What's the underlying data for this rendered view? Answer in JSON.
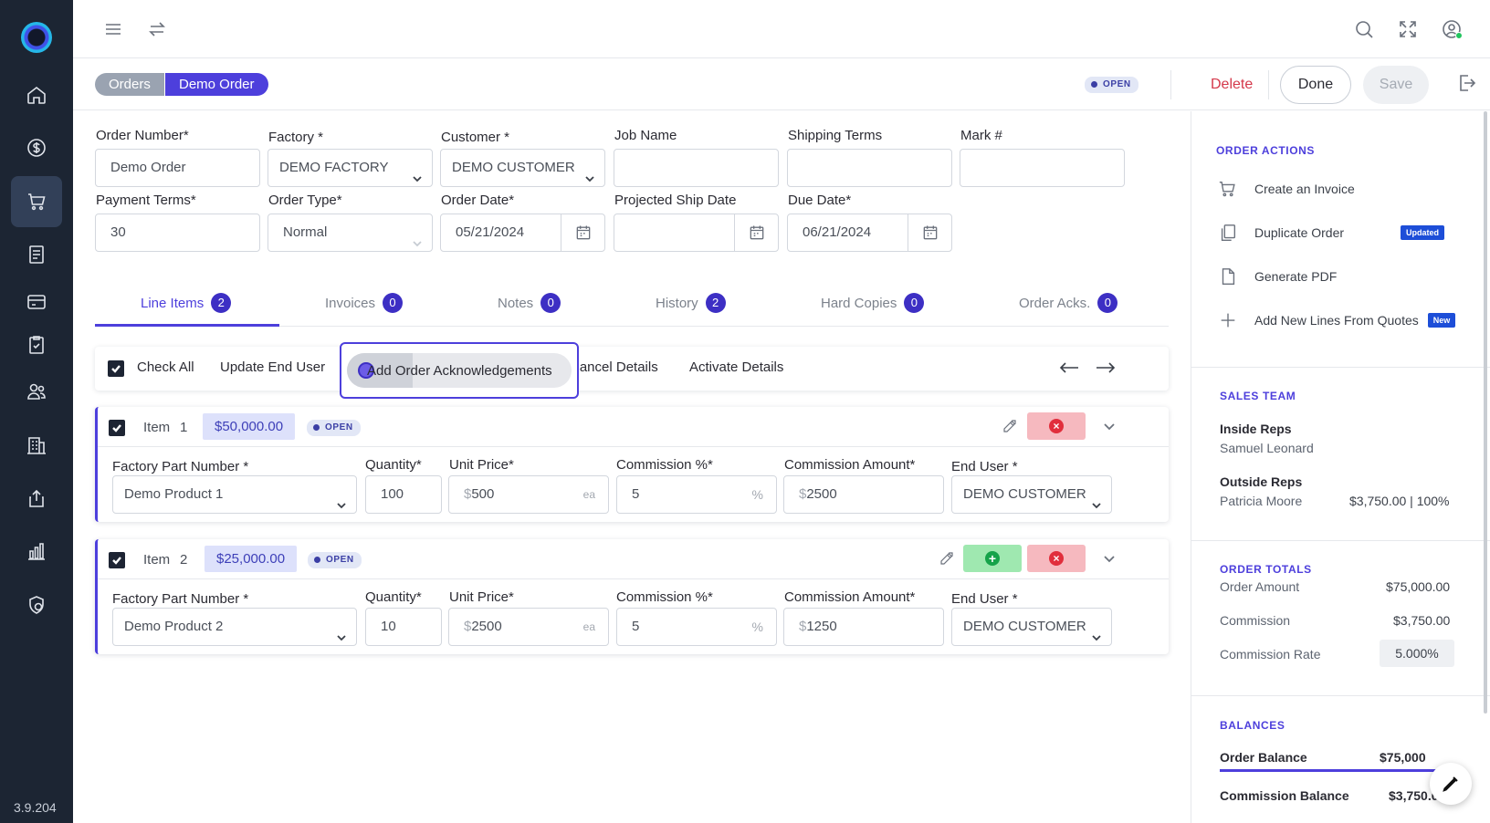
{
  "app": {
    "version": "3.9.204"
  },
  "sidebar": {
    "items": [
      "home-icon",
      "dollar-icon",
      "cart-icon",
      "document-icon",
      "credit-card-icon",
      "clipboard-check-icon",
      "users-icon",
      "building-icon",
      "share-icon",
      "bar-chart-icon",
      "settings-shield-icon"
    ],
    "active": "cart-icon"
  },
  "breadcrumb": {
    "parent": "Orders",
    "current": "Demo Order"
  },
  "status": "OPEN",
  "actions": {
    "delete": "Delete",
    "done": "Done",
    "save": "Save"
  },
  "form": {
    "order_number": {
      "label": "Order Number*",
      "value": "Demo Order"
    },
    "factory": {
      "label": "Factory *",
      "value": "DEMO FACTORY"
    },
    "customer": {
      "label": "Customer *",
      "value": "DEMO CUSTOMER"
    },
    "job_name": {
      "label": "Job Name",
      "value": ""
    },
    "shipping_terms": {
      "label": "Shipping Terms",
      "value": ""
    },
    "mark": {
      "label": "Mark #",
      "value": ""
    },
    "payment_terms": {
      "label": "Payment Terms*",
      "value": "30"
    },
    "order_type": {
      "label": "Order Type*",
      "value": "Normal"
    },
    "order_date": {
      "label": "Order Date*",
      "value": "05/21/2024"
    },
    "projected_ship_date": {
      "label": "Projected Ship Date",
      "value": ""
    },
    "due_date": {
      "label": "Due Date*",
      "value": "06/21/2024"
    }
  },
  "tabs": [
    {
      "label": "Line Items",
      "count": "2"
    },
    {
      "label": "Invoices",
      "count": "0"
    },
    {
      "label": "Notes",
      "count": "0"
    },
    {
      "label": "History",
      "count": "2"
    },
    {
      "label": "Hard Copies",
      "count": "0"
    },
    {
      "label": "Order Acks.",
      "count": "0"
    }
  ],
  "toolbar": {
    "check_all": "Check All",
    "update_end_user": "Update End User",
    "add_order_acks": "Add Order Acknowledgements",
    "cancel_details": "Cancel Details",
    "activate_details": "Activate Details"
  },
  "line_labels": {
    "item": "Item",
    "part_number": "Factory Part Number *",
    "quantity": "Quantity*",
    "unit_price": "Unit Price*",
    "commission_pct": "Commission %*",
    "commission_amount": "Commission Amount*",
    "end_user": "End User *",
    "currency": "$",
    "unit": "ea",
    "percent": "%"
  },
  "line_items": [
    {
      "number": "1",
      "amount": "$50,000.00",
      "status": "OPEN",
      "part": "Demo Product 1",
      "quantity": "100",
      "unit_price": "500",
      "commission_pct": "5",
      "commission_amount": "2500",
      "end_user": "DEMO CUSTOMER"
    },
    {
      "number": "2",
      "amount": "$25,000.00",
      "status": "OPEN",
      "part": "Demo Product 2",
      "quantity": "10",
      "unit_price": "2500",
      "commission_pct": "5",
      "commission_amount": "1250",
      "end_user": "DEMO CUSTOMER"
    }
  ],
  "order_actions": {
    "title": "ORDER ACTIONS",
    "items": [
      {
        "label": "Create an Invoice",
        "tag": ""
      },
      {
        "label": "Duplicate Order",
        "tag": "Updated"
      },
      {
        "label": "Generate PDF",
        "tag": ""
      },
      {
        "label": "Add New Lines From Quotes",
        "tag": "New"
      }
    ]
  },
  "sales_team": {
    "title": "SALES TEAM",
    "inside_label": "Inside Reps",
    "inside_name": "Samuel Leonard",
    "outside_label": "Outside Reps",
    "outside_name": "Patricia Moore",
    "outside_value": "$3,750.00 | 100%"
  },
  "order_totals": {
    "title": "ORDER TOTALS",
    "rows": [
      {
        "label": "Order Amount",
        "value": "$75,000.00"
      },
      {
        "label": "Commission",
        "value": "$3,750.00"
      },
      {
        "label": "Commission Rate",
        "value": "5.000%"
      }
    ]
  },
  "balances": {
    "title": "BALANCES",
    "order_balance_label": "Order Balance",
    "order_balance_value": "$75,000",
    "commission_balance_label": "Commission Balance",
    "commission_balance_value": "$3,750.00"
  },
  "colors": {
    "accent": "#4d3fdc",
    "sidebar": "#1c2533",
    "danger": "#d4384a"
  }
}
